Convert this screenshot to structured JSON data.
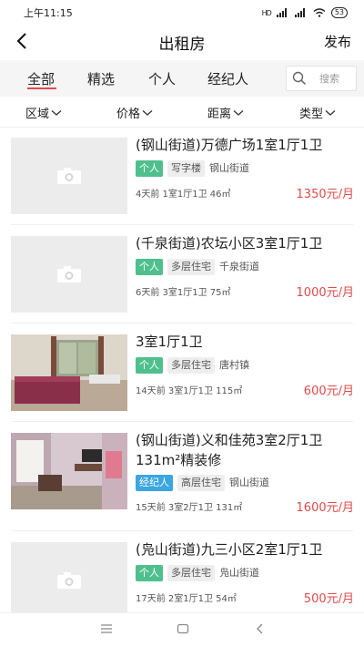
{
  "status": {
    "time": "上午11:15",
    "net_label": "HD",
    "battery": "53"
  },
  "nav": {
    "title": "出租房",
    "publish": "发布"
  },
  "tabs": [
    {
      "label": "全部",
      "active": true
    },
    {
      "label": "精选",
      "active": false
    },
    {
      "label": "个人",
      "active": false
    },
    {
      "label": "经纪人",
      "active": false
    }
  ],
  "search": {
    "placeholder": "搜索"
  },
  "filters": [
    "区域",
    "价格",
    "距离",
    "类型"
  ],
  "listings": [
    {
      "title": "(钢山街道)万德广场1室1厅1卫",
      "tags": [
        {
          "text": "个人",
          "style": "green"
        },
        {
          "text": "写字楼",
          "style": "gray"
        },
        {
          "text": "钢山街道",
          "style": "plain"
        }
      ],
      "meta": "4天前 1室1厅1卫 46㎡",
      "price": "1350元/月",
      "image": "placeholder"
    },
    {
      "title": "(千泉街道)农坛小区3室1厅1卫",
      "tags": [
        {
          "text": "个人",
          "style": "green"
        },
        {
          "text": "多层住宅",
          "style": "gray"
        },
        {
          "text": "千泉街道",
          "style": "plain"
        }
      ],
      "meta": "6天前 3室1厅1卫 75㎡",
      "price": "1000元/月",
      "image": "placeholder"
    },
    {
      "title": "3室1厅1卫",
      "tags": [
        {
          "text": "个人",
          "style": "green"
        },
        {
          "text": "多层住宅",
          "style": "gray"
        },
        {
          "text": "唐村镇",
          "style": "plain"
        }
      ],
      "meta": "14天前 3室1厅1卫 115㎡",
      "price": "600元/月",
      "image": "room-photo"
    },
    {
      "title": "(钢山街道)义和佳苑3室2厅1卫131m²精装修",
      "tags": [
        {
          "text": "经纪人",
          "style": "blue"
        },
        {
          "text": "高层住宅",
          "style": "gray"
        },
        {
          "text": "钢山街道",
          "style": "plain"
        }
      ],
      "meta": "15天前 3室2厅1卫 131㎡",
      "price": "1600元/月",
      "image": "living-photo"
    },
    {
      "title": "(凫山街道)九三小区2室1厅1卫",
      "tags": [
        {
          "text": "个人",
          "style": "green"
        },
        {
          "text": "多层住宅",
          "style": "gray"
        },
        {
          "text": "凫山街道",
          "style": "plain"
        }
      ],
      "meta": "17天前 2室1厅1卫 54㎡",
      "price": "500元/月",
      "image": "placeholder"
    }
  ],
  "colors": {
    "accent": "#e04a4a",
    "tag_green": "#4fc08d",
    "tag_blue": "#3ba6e0"
  }
}
